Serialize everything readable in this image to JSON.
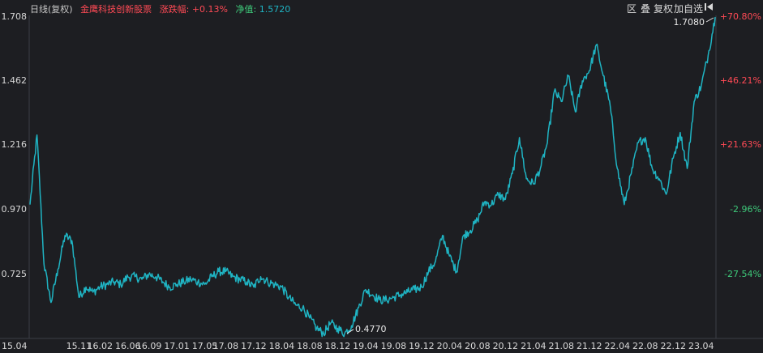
{
  "header": {
    "period": "日线(复权)",
    "fund_name": "金鹰科技创新股票",
    "change_label": "涨跌幅:",
    "change_value": "+0.13%",
    "nav_label": "净值:",
    "nav_value": "1.5720"
  },
  "toolbar": {
    "zone": "区",
    "overlay": "叠",
    "adjust": "复权",
    "add_watch": "加自选",
    "collapse_icon": "collapse-left-icon"
  },
  "colors": {
    "background": "#1d1e22",
    "line": "#1fb4c3",
    "positive": "#ff4a55",
    "negative": "#3ec97a",
    "axis_text": "#d8d8d8",
    "grid": "#33363c"
  },
  "chart_data": {
    "type": "line",
    "title": "金鹰科技创新股票",
    "y_left_ticks": [
      "1.708",
      "1.462",
      "1.216",
      "0.970",
      "0.725"
    ],
    "y_right_ticks": [
      "+70.80%",
      "+46.21%",
      "+21.63%",
      "-2.96%",
      "-27.54%"
    ],
    "x_ticks": [
      "15.04",
      "15.11",
      "16.02",
      "16.06",
      "16.09",
      "17.01",
      "17.05",
      "17.08",
      "17.12",
      "18.04",
      "18.08",
      "18.12",
      "19.04",
      "19.08",
      "19.12",
      "20.04",
      "20.08",
      "20.12",
      "21.04",
      "21.08",
      "21.12",
      "22.04",
      "22.08",
      "22.12",
      "23.04"
    ],
    "ylim": [
      0.47,
      1.708
    ],
    "grid": false,
    "annotations": [
      {
        "label": "1.7080",
        "x": "23.06",
        "y": 1.708
      },
      {
        "label": "0.4770",
        "x": "19.01",
        "y": 0.477
      }
    ],
    "series": [
      {
        "x": [
          "15.04",
          "15.05",
          "15.06",
          "15.07",
          "15.08",
          "15.09",
          "15.10",
          "15.11",
          "15.12",
          "16.01",
          "16.02",
          "16.03",
          "16.04",
          "16.05",
          "16.06",
          "16.07",
          "16.08",
          "16.09",
          "16.10",
          "16.11",
          "16.12",
          "17.01",
          "17.02",
          "17.03",
          "17.04",
          "17.05",
          "17.06",
          "17.07",
          "17.08",
          "17.09",
          "17.10",
          "17.11",
          "17.12",
          "18.01",
          "18.02",
          "18.03",
          "18.04",
          "18.05",
          "18.06",
          "18.07",
          "18.08",
          "18.09",
          "18.10",
          "18.11",
          "18.12",
          "19.01",
          "19.02",
          "19.03",
          "19.04",
          "19.05",
          "19.06",
          "19.07",
          "19.08",
          "19.09",
          "19.10",
          "19.11",
          "19.12",
          "20.01",
          "20.02",
          "20.03",
          "20.04",
          "20.05",
          "20.06",
          "20.07",
          "20.08",
          "20.09",
          "20.10",
          "20.11",
          "20.12",
          "21.01",
          "21.02",
          "21.03",
          "21.04",
          "21.05",
          "21.06",
          "21.07",
          "21.08",
          "21.09",
          "21.10",
          "21.11",
          "21.12",
          "22.01",
          "22.02",
          "22.03",
          "22.04",
          "22.05",
          "22.06",
          "22.07",
          "22.08",
          "22.09",
          "22.10",
          "22.11",
          "22.12",
          "23.01",
          "23.02",
          "23.03",
          "23.04",
          "23.05",
          "23.06"
        ],
        "values": [
          0.98,
          1.25,
          0.75,
          0.6,
          0.73,
          0.86,
          0.84,
          0.62,
          0.66,
          0.64,
          0.66,
          0.67,
          0.68,
          0.67,
          0.7,
          0.7,
          0.69,
          0.71,
          0.7,
          0.68,
          0.66,
          0.67,
          0.68,
          0.69,
          0.68,
          0.67,
          0.7,
          0.72,
          0.72,
          0.7,
          0.69,
          0.68,
          0.66,
          0.7,
          0.68,
          0.67,
          0.66,
          0.62,
          0.59,
          0.58,
          0.54,
          0.5,
          0.48,
          0.52,
          0.5,
          0.48,
          0.51,
          0.58,
          0.65,
          0.63,
          0.61,
          0.61,
          0.62,
          0.63,
          0.64,
          0.65,
          0.66,
          0.72,
          0.76,
          0.86,
          0.78,
          0.72,
          0.86,
          0.88,
          0.92,
          0.99,
          0.98,
          1.02,
          1.0,
          1.1,
          1.24,
          1.08,
          1.06,
          1.12,
          1.22,
          1.42,
          1.38,
          1.48,
          1.34,
          1.46,
          1.5,
          1.6,
          1.48,
          1.36,
          1.12,
          0.98,
          1.1,
          1.22,
          1.24,
          1.12,
          1.08,
          1.02,
          1.16,
          1.26,
          1.12,
          1.38,
          1.44,
          1.56,
          1.708
        ]
      }
    ]
  }
}
